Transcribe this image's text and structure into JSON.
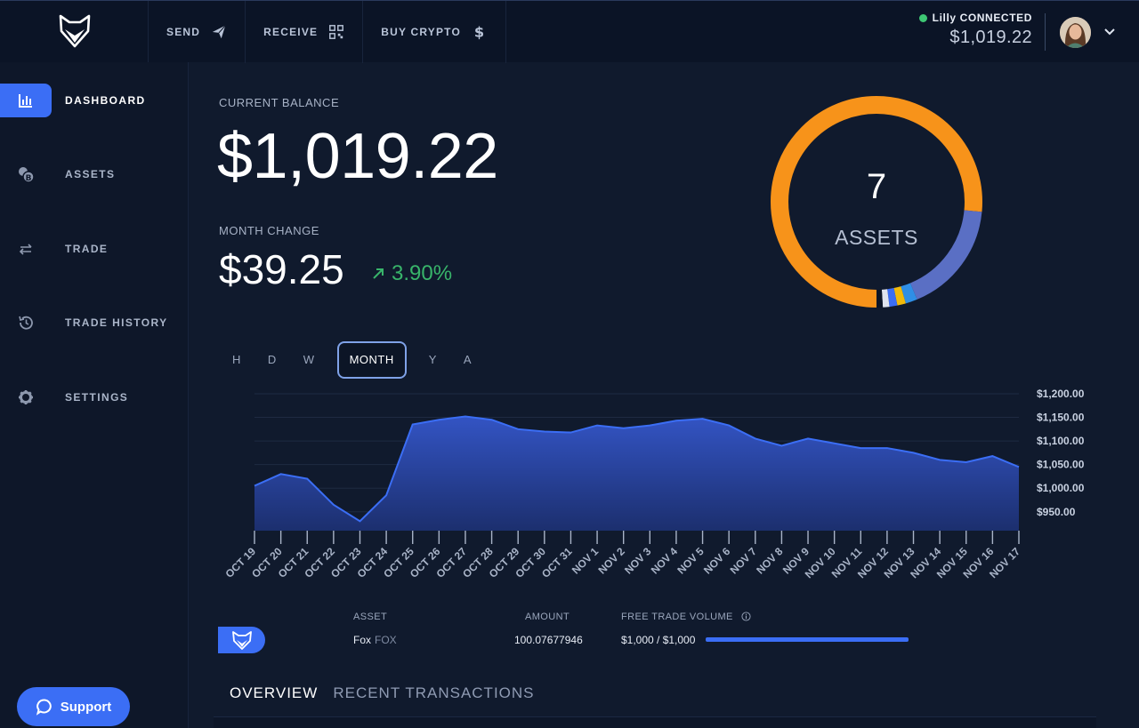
{
  "topnav": {
    "send": "SEND",
    "receive": "RECEIVE",
    "buy": "BUY CRYPTO"
  },
  "account": {
    "name": "Lilly",
    "status": "CONNECTED",
    "balance": "$1,019.22"
  },
  "sidebar": {
    "items": [
      {
        "label": "DASHBOARD",
        "icon": "bar-chart-icon",
        "active": true
      },
      {
        "label": "ASSETS",
        "icon": "coins-icon"
      },
      {
        "label": "TRADE",
        "icon": "swap-arrows-icon"
      },
      {
        "label": "TRADE HISTORY",
        "icon": "history-icon"
      },
      {
        "label": "SETTINGS",
        "icon": "gear-icon"
      }
    ],
    "support": "Support"
  },
  "balance": {
    "current_label": "CURRENT BALANCE",
    "current_value": "$1,019.22",
    "month_label": "MONTH CHANGE",
    "month_value": "$39.25",
    "month_pct": "3.90%"
  },
  "donut": {
    "count": "7",
    "label": "ASSETS",
    "segments": [
      {
        "value": 76.5,
        "color": "#f7931a"
      },
      {
        "value": 17.2,
        "color": "#5a6fc4"
      },
      {
        "value": 1.8,
        "color": "#2f8fe6"
      },
      {
        "value": 1.3,
        "color": "#f0b90b"
      },
      {
        "value": 1.2,
        "color": "#3b6ef5"
      },
      {
        "value": 1.0,
        "color": "#dfe4ee"
      },
      {
        "value": 1.0,
        "color": "#0c1526"
      }
    ]
  },
  "ranges": [
    "H",
    "D",
    "W",
    "MONTH",
    "Y",
    "A"
  ],
  "active_range": "MONTH",
  "chart_data": {
    "type": "area",
    "categories": [
      "OCT 19",
      "OCT 20",
      "OCT 21",
      "OCT 22",
      "OCT 23",
      "OCT 24",
      "OCT 25",
      "OCT 26",
      "OCT 27",
      "OCT 28",
      "OCT 29",
      "OCT 30",
      "OCT 31",
      "NOV 1",
      "NOV 2",
      "NOV 3",
      "NOV 4",
      "NOV 5",
      "NOV 6",
      "NOV 7",
      "NOV 8",
      "NOV 9",
      "NOV 10",
      "NOV 11",
      "NOV 12",
      "NOV 13",
      "NOV 14",
      "NOV 15",
      "NOV 16",
      "NOV 17"
    ],
    "series": [
      {
        "values": [
          1005,
          1030,
          1020,
          965,
          930,
          985,
          1135,
          1145,
          1152,
          1145,
          1125,
          1120,
          1118,
          1133,
          1127,
          1133,
          1143,
          1147,
          1133,
          1105,
          1090,
          1105,
          1095,
          1085,
          1085,
          1075,
          1060,
          1055,
          1068,
          1045
        ]
      }
    ],
    "yticks": [
      "$1,200.00",
      "$1,150.00",
      "$1,100.00",
      "$1,050.00",
      "$1,000.00",
      "$950.00"
    ],
    "ylim": [
      910,
      1200
    ],
    "color": "#3b6ef5",
    "grid": true
  },
  "asset_table": {
    "headers": {
      "asset": "ASSET",
      "amount": "AMOUNT",
      "volume": "FREE TRADE VOLUME"
    },
    "row": {
      "name": "Fox",
      "ticker": "FOX",
      "amount": "100.07677946",
      "volume": "$1,000 / $1,000",
      "volume_fraction": 1.0
    }
  },
  "tabs": [
    "OVERVIEW",
    "RECENT TRANSACTIONS"
  ]
}
